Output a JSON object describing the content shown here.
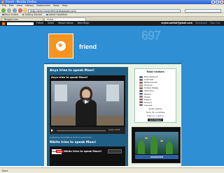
{
  "window": {
    "title": "friend - Mozilla Firefox"
  },
  "menu": [
    "File",
    "Edit",
    "View",
    "History",
    "Bookmarks",
    "Tools",
    "Help"
  ],
  "address": {
    "url": "http://wre-moranfriend.blogspot.com/"
  },
  "bookmarks": [
    "Most Visited",
    "Getting Started",
    "Latest Headlines"
  ],
  "tabs": [
    {
      "label": "Blogger.com"
    },
    {
      "label": "friend"
    }
  ],
  "blogger_nav": {
    "links": [
      "Follow",
      "Share",
      "Report Abuse",
      "Next Blog»"
    ],
    "email": "mykw.amitai@gmail.com",
    "dashboard": "Dashboard",
    "signout": "Sign Out"
  },
  "header": {
    "title": "friend",
    "ghost_text": "697"
  },
  "post1": {
    "title": "Anya tries to speak Maori",
    "video_title": "Anya tries to speak Maori!",
    "time": "0:00 / 0:57",
    "footer": "posted by friend09 at 9:30  0 comments"
  },
  "post2": {
    "title": "Nikita tries to speak Maori",
    "video_title": "Nikita tries to speak Maori!"
  },
  "visitors": {
    "title": "Total visitors",
    "countries": [
      {
        "name": "New Zealand",
        "color": "#00247d"
      },
      {
        "name": "Australia",
        "color": "#012169"
      },
      {
        "name": "Netherlands",
        "color": "#ae1c28"
      },
      {
        "name": "Ukraine",
        "color": "#ffd500"
      },
      {
        "name": "United States",
        "color": "#b22234"
      },
      {
        "name": "Germany",
        "color": "#000000"
      },
      {
        "name": "Russia",
        "color": "#0039a6"
      },
      {
        "name": "Korea",
        "color": "#cd2e3a"
      },
      {
        "name": "Poland",
        "color": "#dc143c"
      },
      {
        "name": "Finland",
        "color": "#003580"
      },
      {
        "name": "Canada",
        "color": "#d52b1e"
      }
    ],
    "total": "1049 visitors",
    "footer": "from 31 countries",
    "map_link": "Map my visitors",
    "button": "Get Widget"
  },
  "aquarium": {
    "caption": "AQUARIUM"
  },
  "status": {
    "text": "Done"
  }
}
